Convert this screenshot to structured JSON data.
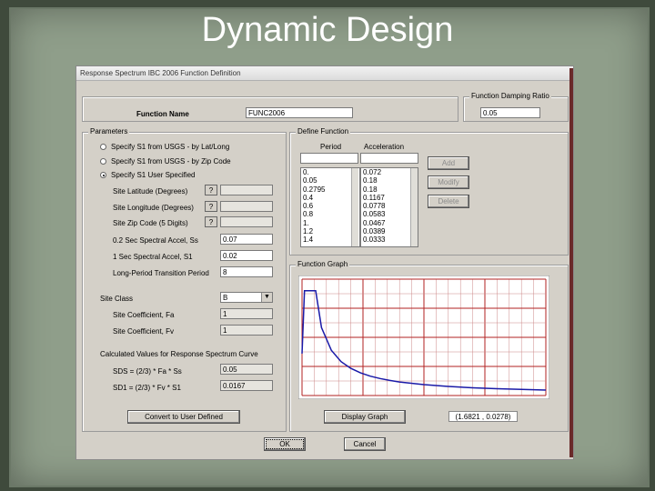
{
  "slide": {
    "title": "Dynamic Design"
  },
  "dialog": {
    "title": "Response Spectrum IBC 2006 Function Definition",
    "function_name_label": "Function Name",
    "function_name_value": "FUNC2006",
    "damping_group_label": "Function Damping Ratio",
    "damping_value": "0.05",
    "parameters": {
      "group_label": "Parameters",
      "radio_options": [
        {
          "label": "Specify S1 from USGS - by Lat/Long",
          "selected": false
        },
        {
          "label": "Specify S1 from USGS - by Zip Code",
          "selected": false
        },
        {
          "label": "Specify S1 User Specified",
          "selected": true
        }
      ],
      "site_latitude_label": "Site Latitude (Degrees)",
      "site_longitude_label": "Site Longitude (Degrees)",
      "site_zip_label": "Site Zip Code (5 Digits)",
      "question_mark": "?",
      "ss_label": "0.2 Sec Spectral Accel, Ss",
      "ss_value": "0.07",
      "s1_label": "1 Sec Spectral Accel, S1",
      "s1_value": "0.02",
      "tl_label": "Long-Period Transition Period",
      "tl_value": "8",
      "site_class_label": "Site Class",
      "site_class_value": "B",
      "fa_label": "Site Coefficient, Fa",
      "fa_value": "1",
      "fv_label": "Site Coefficient, Fv",
      "fv_value": "1",
      "calc_label": "Calculated Values for Response Spectrum Curve",
      "sds_label": "SDS = (2/3) * Fa * Ss",
      "sds_value": "0.05",
      "sd1_label": "SD1 = (2/3) * Fv * S1",
      "sd1_value": "0.0167",
      "convert_button": "Convert to User Defined"
    },
    "define_function": {
      "group_label": "Define Function",
      "period_header": "Period",
      "accel_header": "Acceleration",
      "periods": [
        "0.",
        "0.05",
        "0.2795",
        "0.4",
        "0.6",
        "0.8",
        "1.",
        "1.2",
        "1.4"
      ],
      "accelerations": [
        "0.072",
        "0.18",
        "0.18",
        "0.1167",
        "0.0778",
        "0.0583",
        "0.0467",
        "0.0389",
        "0.0333"
      ],
      "add_button": "Add",
      "modify_button": "Modify",
      "delete_button": "Delete"
    },
    "function_graph": {
      "group_label": "Function Graph",
      "display_button": "Display Graph",
      "coord_readout": "(1.6821 , 0.0278)"
    },
    "ok_button": "OK",
    "cancel_button": "Cancel"
  },
  "chart_data": {
    "type": "line",
    "title": "",
    "xlabel": "",
    "ylabel": "",
    "x": [
      0,
      0.05,
      0.2795,
      0.4,
      0.6,
      0.8,
      1.0,
      1.2,
      1.4,
      1.6,
      1.8,
      2.0,
      2.5,
      3.0,
      3.5,
      4.0,
      4.5,
      5.0
    ],
    "series": [
      {
        "values": [
          0.072,
          0.18,
          0.18,
          0.1167,
          0.0778,
          0.0583,
          0.0467,
          0.0389,
          0.0333,
          0.0292,
          0.0259,
          0.0233,
          0.0187,
          0.0156,
          0.0133,
          0.0117,
          0.0104,
          0.0093
        ]
      }
    ],
    "xlim": [
      0,
      5
    ],
    "ylim": [
      0,
      0.2
    ],
    "grid": true,
    "colors": {
      "line": "#1a1aa8",
      "grid": "#b22222",
      "background": "#ffffff"
    }
  }
}
